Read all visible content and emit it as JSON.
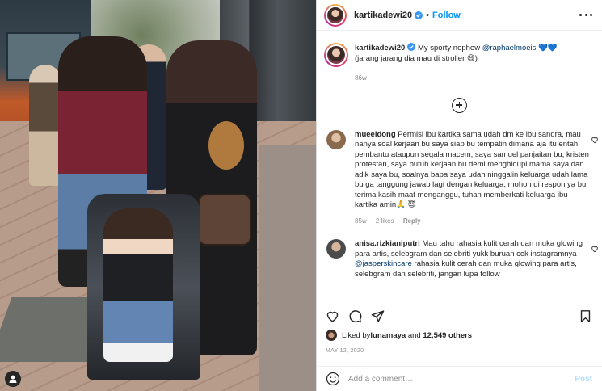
{
  "post": {
    "username": "kartikadewi20",
    "follow_label": "Follow",
    "dot": "•",
    "photo_alt_icon": "user-icon"
  },
  "caption": {
    "username": "kartikadewi20",
    "text_before": " My sporty nephew ",
    "mention": "@raphaelmoeis",
    "text_emoji": " 💙💙",
    "line2": "(jarang jarang dia mau di stroller 😄)",
    "age": "86w"
  },
  "comments": [
    {
      "username": "mueeldong",
      "text": " Permisi ibu kartika sama udah dm ke ibu sandra, mau nanya soal kerjaan bu saya siap bu tempatin dimana aja itu entah pembantu ataupun segala macem, saya samuel panjaitan bu, kristen protestan, saya butuh kerjaan bu demi menghidupi mama saya dan adik saya bu, soalnya bapa saya udah ninggalin keluarga udah lama bu ga tanggung jawab lagi dengan keluarga, mohon di respon ya bu, terima kasih maaf menganggu, tuhan memberkati keluarga ibu kartika amin🙏 😇",
      "age": "85w",
      "likes": "2 likes",
      "reply": "Reply",
      "avatar_color": "#8a6a4f"
    },
    {
      "username": "anisa.rizkianiputri",
      "text_before": " Mau tahu rahasia kulit cerah dan muka glowing para artis, selebgram dan selebriti yukk buruan cek instagramnya ",
      "mention": "@jasperskincare",
      "text_after": " rahasia kulit cerah dan muka glowing para artis, selebgram dan selebriti, jangan lupa follow",
      "avatar_color": "#4b4b4b"
    }
  ],
  "likes": {
    "prefix": "Liked by ",
    "user": "lunamaya",
    "middle": " and ",
    "others": "12,549 others"
  },
  "date": "MAY 12, 2020",
  "add_comment": {
    "placeholder": "Add a comment…",
    "post_label": "Post"
  },
  "colors": {
    "accent": "#0095f6",
    "verified": "#3897f0",
    "muted": "#8e8e8e",
    "post_disabled": "#b2dffc"
  }
}
